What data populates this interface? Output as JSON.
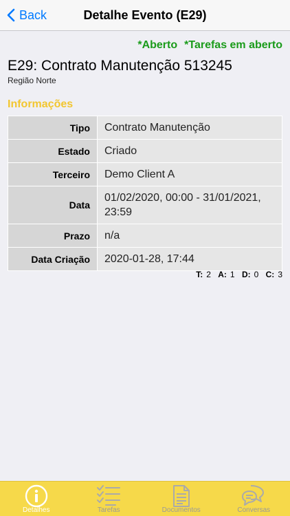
{
  "nav": {
    "back_label": "Back",
    "title": "Detalhe Evento (E29)"
  },
  "status": {
    "aberto": "*Aberto",
    "tarefas": "*Tarefas em aberto",
    "color": "#1a9b1a"
  },
  "event": {
    "title": "E29: Contrato Manutenção 513245",
    "region": "Região Norte"
  },
  "section_title": "Informações",
  "info": {
    "rows": [
      {
        "key": "Tipo",
        "value": "Contrato Manutenção"
      },
      {
        "key": "Estado",
        "value": "Criado"
      },
      {
        "key": "Terceiro",
        "value": "Demo Client A"
      },
      {
        "key": "Data",
        "value": "01/02/2020, 00:00 - 31/01/2021, 23:59"
      },
      {
        "key": "Prazo",
        "value": "n/a"
      },
      {
        "key": "Data Criação",
        "value": "2020-01-28, 17:44"
      }
    ]
  },
  "counters": {
    "t_label": "T:",
    "t_value": "2",
    "a_label": "A:",
    "a_value": "1",
    "d_label": "D:",
    "d_value": "0",
    "c_label": "C:",
    "c_value": "3"
  },
  "tabs": [
    {
      "label": "Detalhes",
      "icon": "info-icon",
      "active": true
    },
    {
      "label": "Tarefas",
      "icon": "checklist-icon"
    },
    {
      "label": "Documentos",
      "icon": "document-icon"
    },
    {
      "label": "Conversas",
      "icon": "chat-icon"
    }
  ],
  "colors": {
    "accent": "#007aff",
    "section": "#f2c630",
    "tabbar": "#f6d94a"
  }
}
